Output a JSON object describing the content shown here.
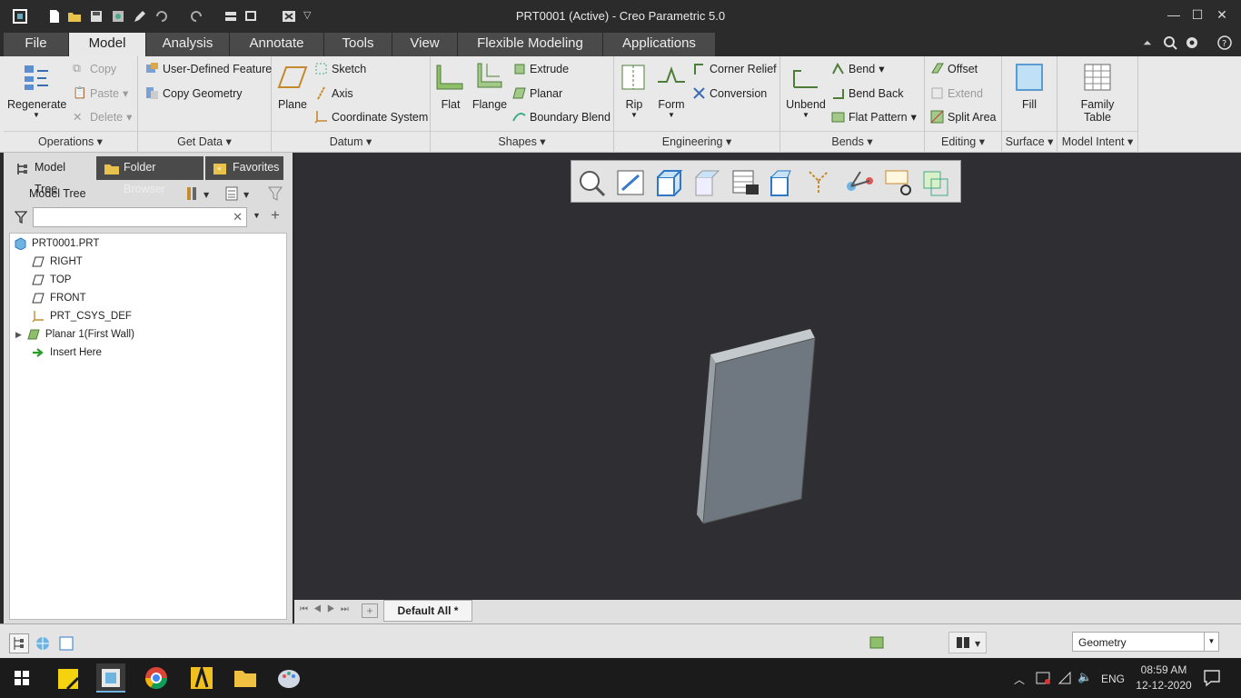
{
  "window": {
    "title": "PRT0001 (Active) - Creo Parametric 5.0"
  },
  "tabs": [
    "File",
    "Model",
    "Analysis",
    "Annotate",
    "Tools",
    "View",
    "Flexible Modeling",
    "Applications"
  ],
  "ribbon": {
    "operations": {
      "regenerate": "Regenerate",
      "copy": "Copy",
      "paste": "Paste",
      "delete": "Delete",
      "label": "Operations"
    },
    "get_data": {
      "udf": "User-Defined Feature",
      "copy_geometry": "Copy Geometry",
      "label": "Get Data"
    },
    "datum": {
      "plane": "Plane",
      "sketch": "Sketch",
      "axis": "Axis",
      "csys": "Coordinate System",
      "label": "Datum"
    },
    "shapes": {
      "flat": "Flat",
      "flange": "Flange",
      "extrude": "Extrude",
      "planar": "Planar",
      "boundary_blend": "Boundary Blend",
      "label": "Shapes"
    },
    "engineering": {
      "rip": "Rip",
      "form": "Form",
      "corner_relief": "Corner Relief",
      "conversion": "Conversion",
      "label": "Engineering"
    },
    "bends": {
      "unbend": "Unbend",
      "bend": "Bend",
      "bend_back": "Bend Back",
      "flat_pattern": "Flat Pattern",
      "label": "Bends"
    },
    "editing": {
      "offset": "Offset",
      "extend": "Extend",
      "split_area": "Split Area",
      "label": "Editing"
    },
    "surface": {
      "fill": "Fill",
      "label": "Surface"
    },
    "model_intent": {
      "family_table": "Family Table",
      "label": "Model Intent"
    }
  },
  "left_panel": {
    "tabs": [
      "Model Tree",
      "Folder Browser",
      "Favorites"
    ],
    "tree_title": "Model Tree",
    "search_placeholder": "",
    "tree": [
      "PRT0001.PRT",
      "RIGHT",
      "TOP",
      "FRONT",
      "PRT_CSYS_DEF",
      "Planar 1(First Wall)",
      "Insert Here"
    ]
  },
  "sheet_tab": "Default All *",
  "status": {
    "filter": "Geometry"
  },
  "taskbar": {
    "lang": "ENG",
    "time": "08:59 AM",
    "date": "12-12-2020"
  },
  "colors": {
    "accent": "#2f78c8",
    "viewport_bg": "#2f2f33",
    "part_face": "#6f7880"
  }
}
